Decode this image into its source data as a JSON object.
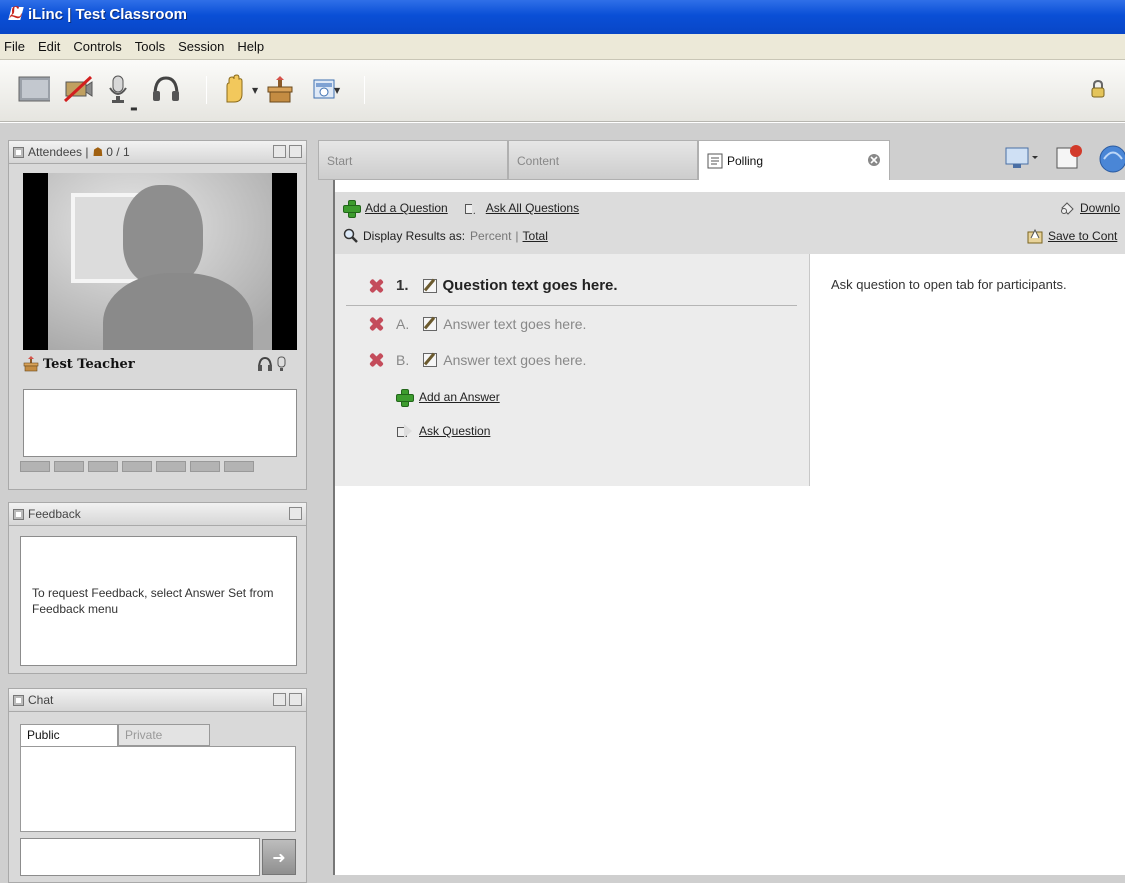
{
  "window": {
    "title": "iLinc | Test Classroom"
  },
  "menu": [
    "File",
    "Edit",
    "Controls",
    "Tools",
    "Session",
    "Help"
  ],
  "attendees": {
    "label": "Attendees |",
    "count": "0 / 1"
  },
  "teacher": {
    "name": "Test Teacher"
  },
  "feedback": {
    "label": "Feedback",
    "message": "To request Feedback, select Answer Set from Feedback menu"
  },
  "chat": {
    "label": "Chat",
    "tabs": [
      "Public",
      "Private"
    ]
  },
  "tabs": {
    "start": "Start",
    "content": "Content",
    "polling": "Polling"
  },
  "polling": {
    "add_question": "Add a Question",
    "ask_all": "Ask All Questions",
    "display_results_as": "Display Results as:",
    "percent": "Percent",
    "separator": "|",
    "total": "Total",
    "download": "Downlo",
    "save_to_content": "Save to Cont",
    "question_number": "1.",
    "question_text": "Question text goes here.",
    "answers": [
      {
        "letter": "A.",
        "text": "Answer text goes here."
      },
      {
        "letter": "B.",
        "text": "Answer text goes here."
      }
    ],
    "add_answer": "Add an Answer",
    "ask_question": "Ask Question",
    "info": "Ask question to open tab for participants."
  },
  "colors": {
    "titlebar": "#0a4fd6",
    "accent_red": "#c44c5b",
    "accent_green": "#3d9c2e"
  }
}
